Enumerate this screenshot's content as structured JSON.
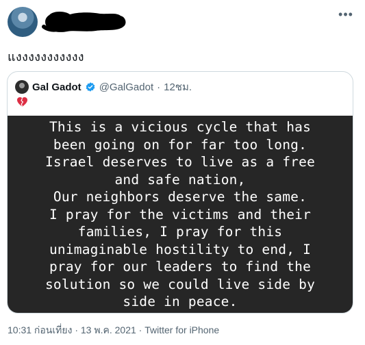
{
  "tweet": {
    "text": "แงงงงงงงงงงง"
  },
  "quoted_tweet": {
    "display_name": "Gal Gadot",
    "handle": "@GalGadot",
    "separator": "·",
    "time_ago": "12ชม.",
    "emoji_icon": "broken-heart-icon",
    "verified_color": "#1d9bf0",
    "image_text": "This is a vicious cycle that has\nbeen going on for far too long.\nIsrael deserves to live as a free\nand safe nation,\nOur neighbors deserve the same.\nI pray for the victims and their\nfamilies, I pray for this\nunimaginable hostility to end, I\npray for our leaders to find the\nsolution so we could live side by\nside in peace."
  },
  "meta": {
    "time": "10:31 ก่อนเที่ยง",
    "separator": "·",
    "date": "13 พ.ค. 2021",
    "source": "Twitter for iPhone"
  }
}
